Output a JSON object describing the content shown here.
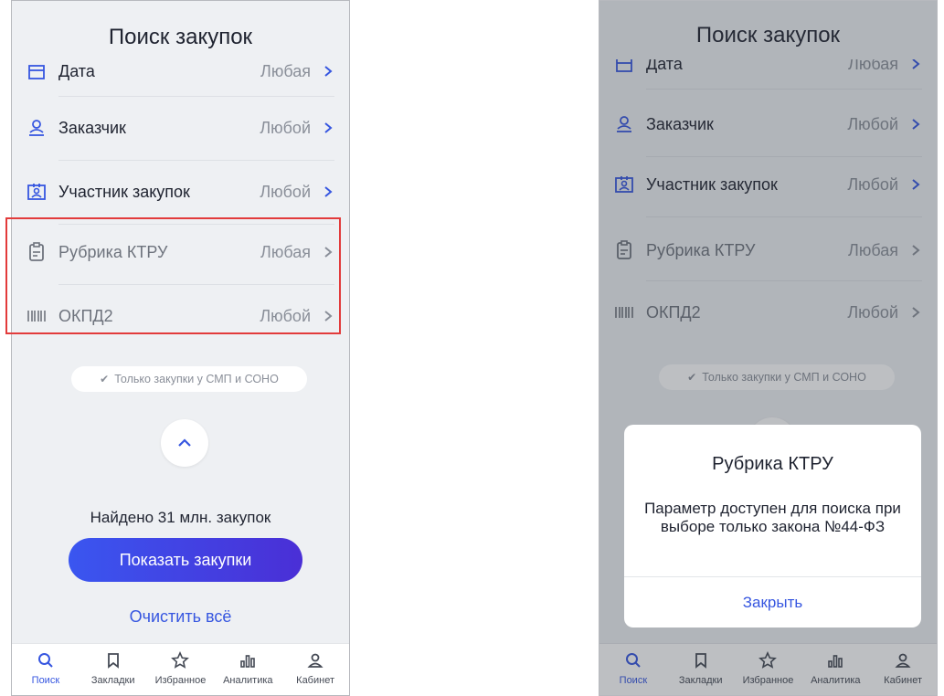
{
  "title": "Поиск закупок",
  "rows": [
    {
      "label": "Дата",
      "value": "Любая"
    },
    {
      "label": "Заказчик",
      "value": "Любой"
    },
    {
      "label": "Участник закупок",
      "value": "Любой"
    },
    {
      "label": "Рубрика КТРУ",
      "value": "Любая"
    },
    {
      "label": "ОКПД2",
      "value": "Любой"
    }
  ],
  "chip": "Только закупки у СМП и СОНО",
  "found": "Найдено 31 млн. закупок",
  "show_button": "Показать закупки",
  "clear": "Очистить всё",
  "tabs": [
    {
      "label": "Поиск",
      "icon": "search-icon"
    },
    {
      "label": "Закладки",
      "icon": "bookmark-icon"
    },
    {
      "label": "Избранное",
      "icon": "star-icon"
    },
    {
      "label": "Аналитика",
      "icon": "analytics-icon"
    },
    {
      "label": "Кабинет",
      "icon": "profile-icon"
    }
  ],
  "dialog": {
    "title": "Рубрика КТРУ",
    "message": "Параметр доступен для поиска при выборе только закона №44-ФЗ",
    "close": "Закрыть"
  },
  "colors": {
    "accent": "#3656e0",
    "highlight": "#e23b3b",
    "background": "#eef0f3"
  }
}
